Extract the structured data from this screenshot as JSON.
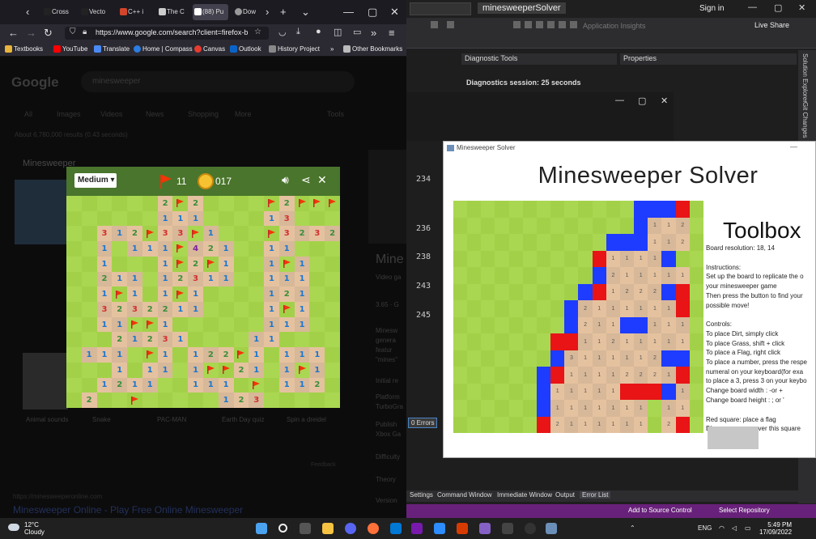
{
  "firefox": {
    "tabs": [
      "Cross",
      "Vecto",
      "C++ i",
      "The C",
      "(88) Pu",
      "Dow"
    ],
    "url": "https://www.google.com/search?client=firefox-b",
    "bookmarks": [
      "Textbooks",
      "YouTube",
      "Translate",
      "Home | Compass",
      "Canvas",
      "Outlook",
      "History Project",
      "Other Bookmarks"
    ]
  },
  "google": {
    "logo": "Google",
    "query": "minesweeper",
    "tabs": [
      "All",
      "Images",
      "Videos",
      "News",
      "Shopping",
      "More",
      "Tools"
    ],
    "about": "About 6,780,000 results (0.43 seconds)",
    "heading": "Minesweeper",
    "captions": [
      "Animal sounds",
      "Snake",
      "PAC-MAN",
      "Earth Day quiz",
      "Spin a dreidel"
    ],
    "knowledge_title": "Mine",
    "knowledge_lines": [
      "Video ga",
      "3.65 · G",
      "Minesw",
      "genera",
      "featur",
      "\"mines\"",
      "Initial re",
      "Platform",
      "TurboGra",
      "Publish",
      "Xbox Ga",
      "Difficulty",
      "Theory",
      "Version"
    ],
    "feedback": "Feedback",
    "result_link": "https://minesweeperonline.com",
    "result_title": "Minesweeper Online - Play Free Online Minesweeper"
  },
  "game": {
    "difficulty": "Medium",
    "flags": "11",
    "time": "017",
    "rows": [
      [
        "u",
        "u",
        "u",
        "u",
        "u",
        "u",
        "2",
        "F",
        "2",
        "u",
        "u",
        "u",
        "u",
        "F",
        "2",
        "F",
        "F",
        "F"
      ],
      [
        "u",
        "u",
        "u",
        "u",
        "u",
        "u",
        "1",
        "1",
        "1",
        "u",
        "u",
        "u",
        "u",
        "1",
        "3",
        "u",
        "u",
        "u"
      ],
      [
        "u",
        "u",
        "3",
        "1",
        "2",
        "F",
        "3",
        "3",
        "F",
        "1",
        "u",
        "u",
        "u",
        "F",
        "3",
        "2",
        "3",
        "2"
      ],
      [
        "u",
        "u",
        "1",
        "u",
        "1",
        "1",
        "1",
        "F",
        "4",
        "2",
        "1",
        "u",
        "u",
        "1",
        "1",
        "u",
        "u",
        "u"
      ],
      [
        "u",
        "u",
        "1",
        "u",
        "u",
        "u",
        "1",
        "F",
        "2",
        "F",
        "1",
        "u",
        "u",
        "1",
        "F",
        "1",
        "u",
        "u"
      ],
      [
        "u",
        "u",
        "2",
        "1",
        "1",
        "u",
        "1",
        "2",
        "3",
        "1",
        "1",
        "u",
        "u",
        "1",
        "1",
        "1",
        "u",
        "u"
      ],
      [
        "u",
        "u",
        "1",
        "F",
        "1",
        "u",
        "1",
        "F",
        "1",
        "u",
        "u",
        "u",
        "u",
        "1",
        "2",
        "1",
        "u",
        "u"
      ],
      [
        "u",
        "u",
        "3",
        "2",
        "3",
        "2",
        "2",
        "1",
        "1",
        "u",
        "u",
        "u",
        "u",
        "1",
        "F",
        "1",
        "u",
        "u"
      ],
      [
        "u",
        "u",
        "1",
        "1",
        "F",
        "F",
        "1",
        "u",
        "u",
        "u",
        "u",
        "u",
        "u",
        "1",
        "1",
        "1",
        "u",
        "u"
      ],
      [
        "u",
        "u",
        "u",
        "2",
        "1",
        "2",
        "3",
        "1",
        "u",
        "u",
        "u",
        "u",
        "1",
        "1",
        "u",
        "u",
        "u",
        "u"
      ],
      [
        "u",
        "1",
        "1",
        "1",
        "u",
        "F",
        "1",
        "u",
        "1",
        "2",
        "2",
        "F",
        "1",
        "u",
        "1",
        "1",
        "1",
        "u"
      ],
      [
        "u",
        "u",
        "u",
        "1",
        "u",
        "1",
        "1",
        "u",
        "1",
        "F",
        "F",
        "2",
        "1",
        "u",
        "1",
        "F",
        "1",
        "u"
      ],
      [
        "u",
        "u",
        "1",
        "2",
        "1",
        "1",
        "u",
        "u",
        "1",
        "1",
        "1",
        "u",
        "F",
        "u",
        "1",
        "1",
        "2",
        "u"
      ],
      [
        "u",
        "2",
        "u",
        "u",
        "F",
        "u",
        "u",
        "u",
        "u",
        "u",
        "1",
        "2",
        "3",
        "u",
        "u",
        "u",
        "u",
        "u"
      ]
    ]
  },
  "solver": {
    "window_title": "Minesweeper Solver",
    "heading": "Minesweeper Solver",
    "toolbox_title": "Toolbox",
    "resolution": "Board resolution: 18, 14",
    "instructions_title": "Instructions:",
    "instructions": [
      "Set up the board to replicate the o",
      "your minesweeper game",
      "Then press the button to find your",
      "possible move!"
    ],
    "controls_title": "Controls:",
    "controls": [
      "To place Dirt, simply click",
      "To place Grass, shift + click",
      "To place a Flag, right click",
      "To place a number, press the respe",
      "numeral on your keyboard(for exa",
      "to place a 3, press 3 on your keybo",
      "Change board width : -or +",
      "Change board height : ; or '"
    ],
    "legend": [
      "Red square: place a flag",
      "Blue square: uncover this square"
    ],
    "rows": [
      "gggggggggggggbbbrg",
      "gggggggggggggb112g",
      "gggggggggggbbb112g",
      "ggggggggggr1111bgg",
      "ggggggggggb211111g",
      "gggggggggbr1222brg",
      "ggggggggb2111111rg",
      "ggggggggb211bb111g",
      "gggggggrr11211111g",
      "gggggggb3111112bbg",
      "ggggggbr11112221rg",
      "ggggggb11111rrrb1g",
      "ggggggb1111111g11g",
      "ggggggr2111111g2rg"
    ]
  },
  "vs": {
    "solution_name": "minesweeperSolver",
    "signin": "Sign in",
    "app_insights": "Application Insights",
    "live_share": "Live Share",
    "panel_diag": "Diagnostic Tools",
    "panel_props": "Properties",
    "diag_session": "Diagnostics session: 25 seconds",
    "line_nums": [
      "234",
      "236",
      "238",
      "243",
      "245"
    ],
    "errors_tab": "0 Errors",
    "bottom_tabs": [
      "Settings",
      "Command Window",
      "Immediate Window",
      "Output",
      "Error List"
    ],
    "status_source": "Add to Source Control",
    "status_repo": "Select Repository",
    "side_tabs": [
      "Solution Explorer",
      "Git Changes"
    ]
  },
  "taskbar": {
    "temp": "12°C",
    "weather": "Cloudy",
    "lang": "ENG",
    "time": "5:49 PM",
    "date": "17/09/2022"
  },
  "colors": {
    "ms_grass_light": "#aad751",
    "ms_grass_dark": "#a2d149",
    "ms_dirt_light": "#e5c29f",
    "ms_dirt_dark": "#d7b899",
    "solver_red": "#e81416",
    "solver_blue": "#1e3cff",
    "vs_status": "#68217a"
  }
}
